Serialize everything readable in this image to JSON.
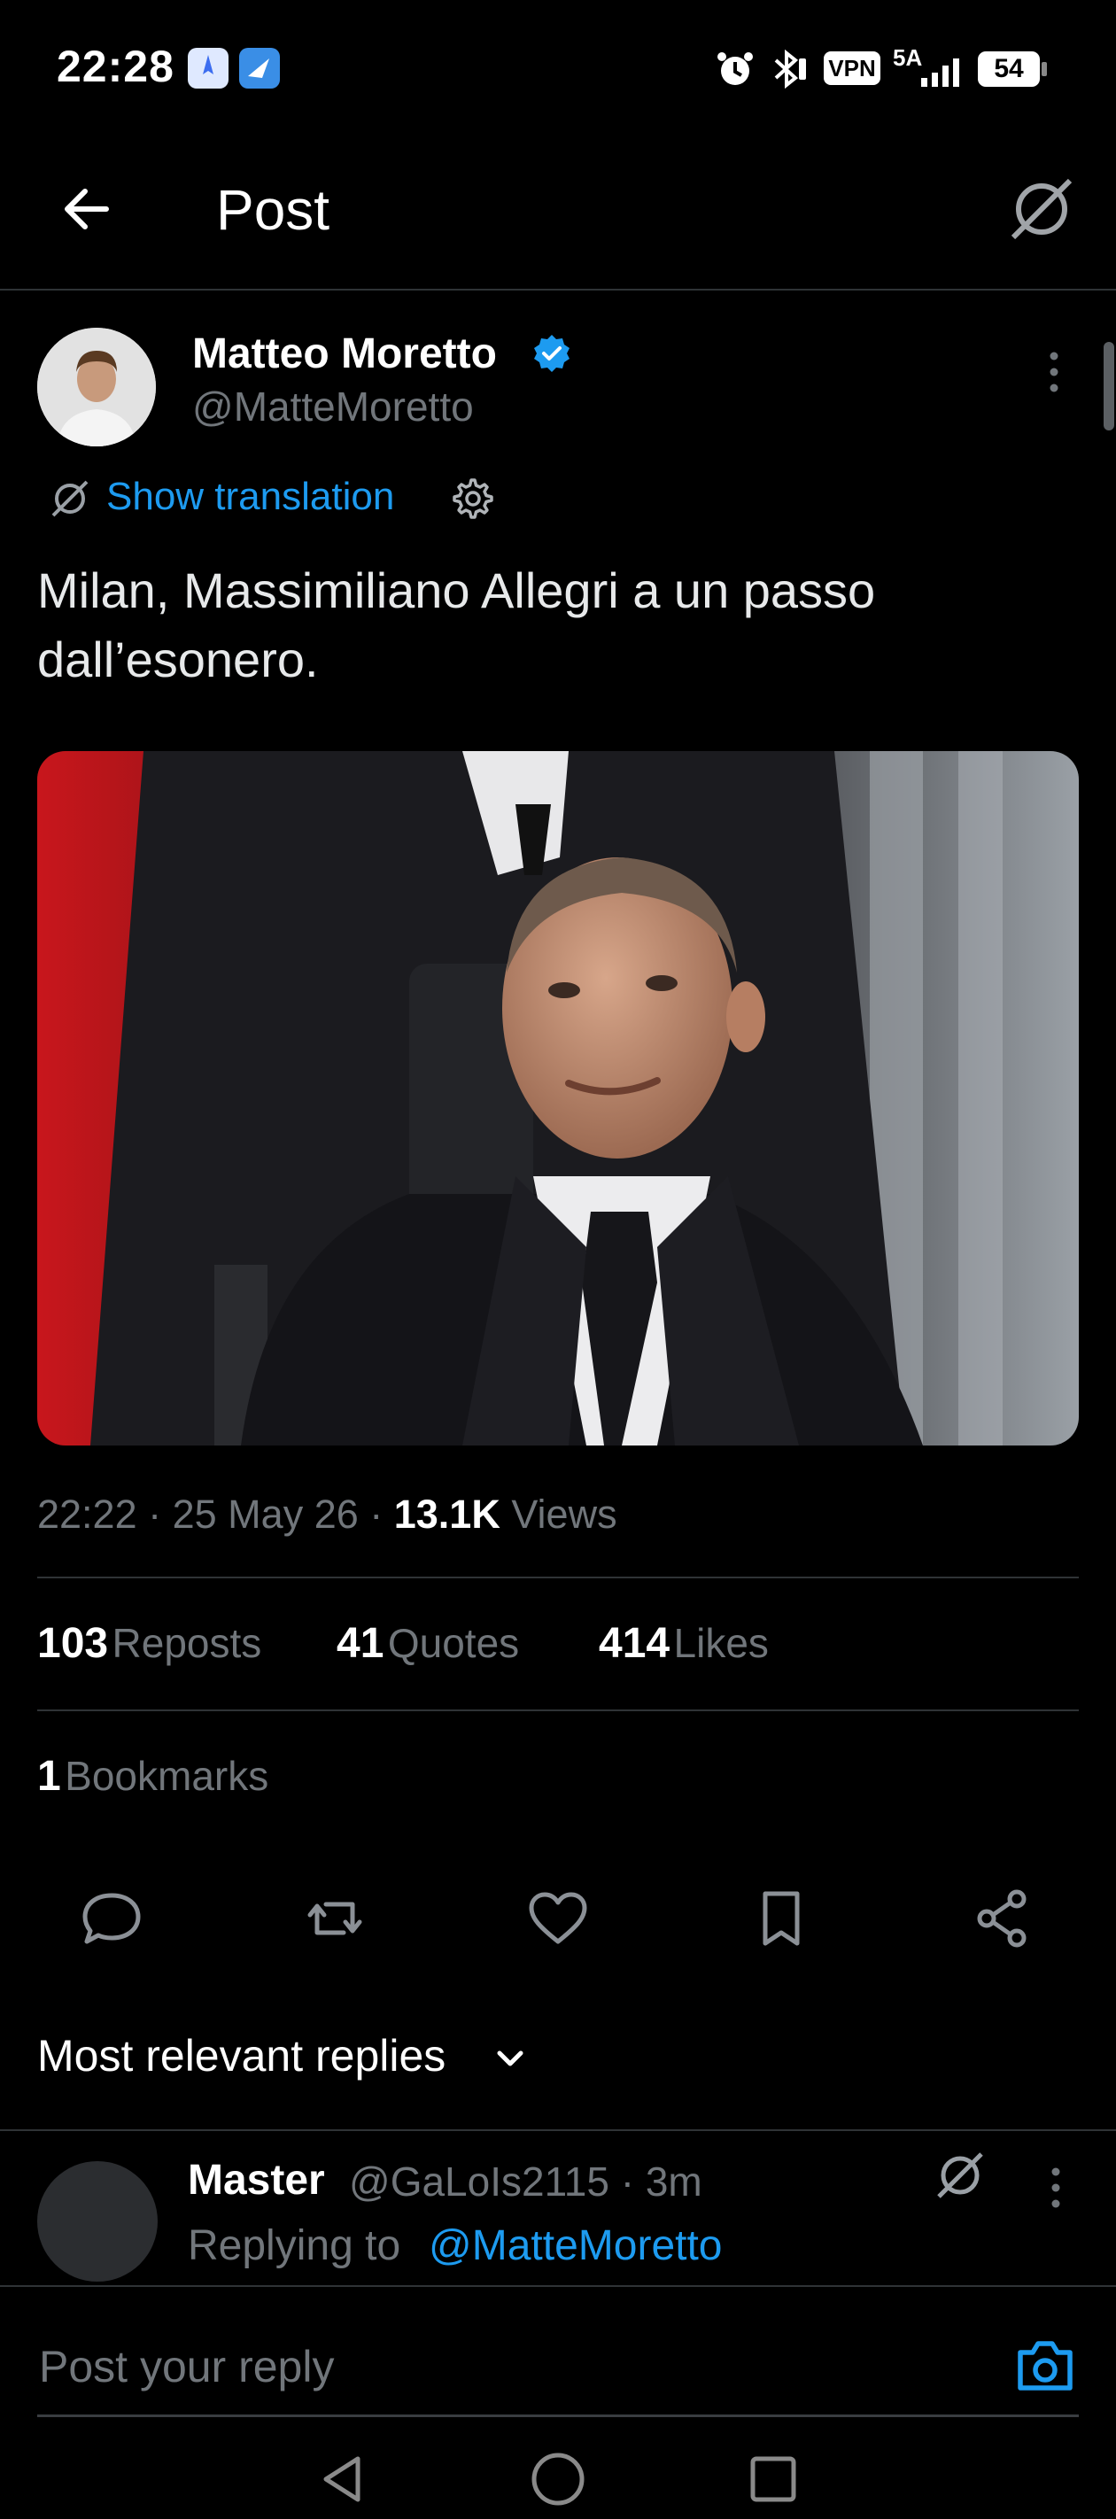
{
  "status_bar": {
    "time": "22:28",
    "network": "5A",
    "vpn_label": "VPN",
    "battery": "54"
  },
  "header": {
    "title": "Post",
    "back_icon": "arrow-left-icon",
    "grok_icon": "grok-icon"
  },
  "post": {
    "author_name": "Matteo Moretto",
    "author_handle": "@MatteMoretto",
    "verified": true,
    "translate_label": "Show translation",
    "text": "Milan, Massimiliano Allegri a un passo dall’esonero.",
    "time": "22:22",
    "date": "25 May 26",
    "views_count": "13.1K",
    "views_label": "Views"
  },
  "stats": {
    "reposts_count": "103",
    "reposts_label": "Reposts",
    "quotes_count": "41",
    "quotes_label": "Quotes",
    "likes_count": "414",
    "likes_label": "Likes",
    "bookmarks_count": "1",
    "bookmarks_label": "Bookmarks"
  },
  "actions": [
    "reply-icon",
    "repost-icon",
    "like-icon",
    "bookmark-icon",
    "share-icon"
  ],
  "replies": {
    "sort_label": "Most relevant replies",
    "items": [
      {
        "name": "Master",
        "handle": "@GaLoIs2115",
        "time": "3m",
        "replying_to_label": "Replying to",
        "replying_to_handle": "@MatteMoretto"
      }
    ]
  },
  "composer": {
    "placeholder": "Post your reply"
  },
  "colors": {
    "background": "#000000",
    "accent": "#1d9bf0",
    "muted": "#71767b",
    "divider": "#2f3336"
  }
}
